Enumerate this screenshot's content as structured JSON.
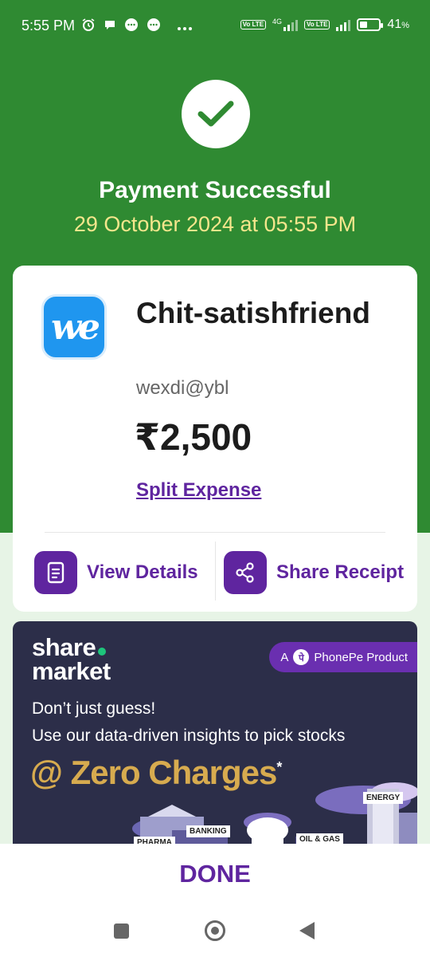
{
  "status_bar": {
    "time": "5:55 PM",
    "icons": [
      "alarm-icon",
      "chat-icon",
      "message-icon",
      "message-icon",
      "more-dots-icon"
    ],
    "network": "4G",
    "volte": "Vo LTE",
    "battery_text": "41",
    "battery_unit": "%",
    "battery_level": 0.41
  },
  "header": {
    "status_icon": "check-icon",
    "title": "Payment Successful",
    "datetime": "29 October 2024 at 05:55 PM",
    "bg_color": "#2f8a32"
  },
  "payment_card": {
    "logo_text": "we",
    "payee_name": "Chit-satishfriend",
    "upi_id": "wexdi@ybl",
    "amount": "₹2,500",
    "split_label": "Split Expense",
    "actions": [
      {
        "label": "View Details",
        "icon": "document-icon"
      },
      {
        "label": "Share Receipt",
        "icon": "share-icon"
      }
    ],
    "accent_color": "#5f259f"
  },
  "banner": {
    "brand_line1": "share",
    "brand_line2": "market",
    "badge_prefix": "A",
    "badge_text": "PhonePe Product",
    "line1": "Don’t just guess!",
    "line2": "Use our data-driven insights to pick stocks",
    "headline": "@ Zero Charges",
    "headline_mark": "*",
    "tags": [
      "ENERGY",
      "BANKING",
      "PHARMA",
      "OIL & GAS"
    ]
  },
  "footer": {
    "done_label": "DONE"
  }
}
